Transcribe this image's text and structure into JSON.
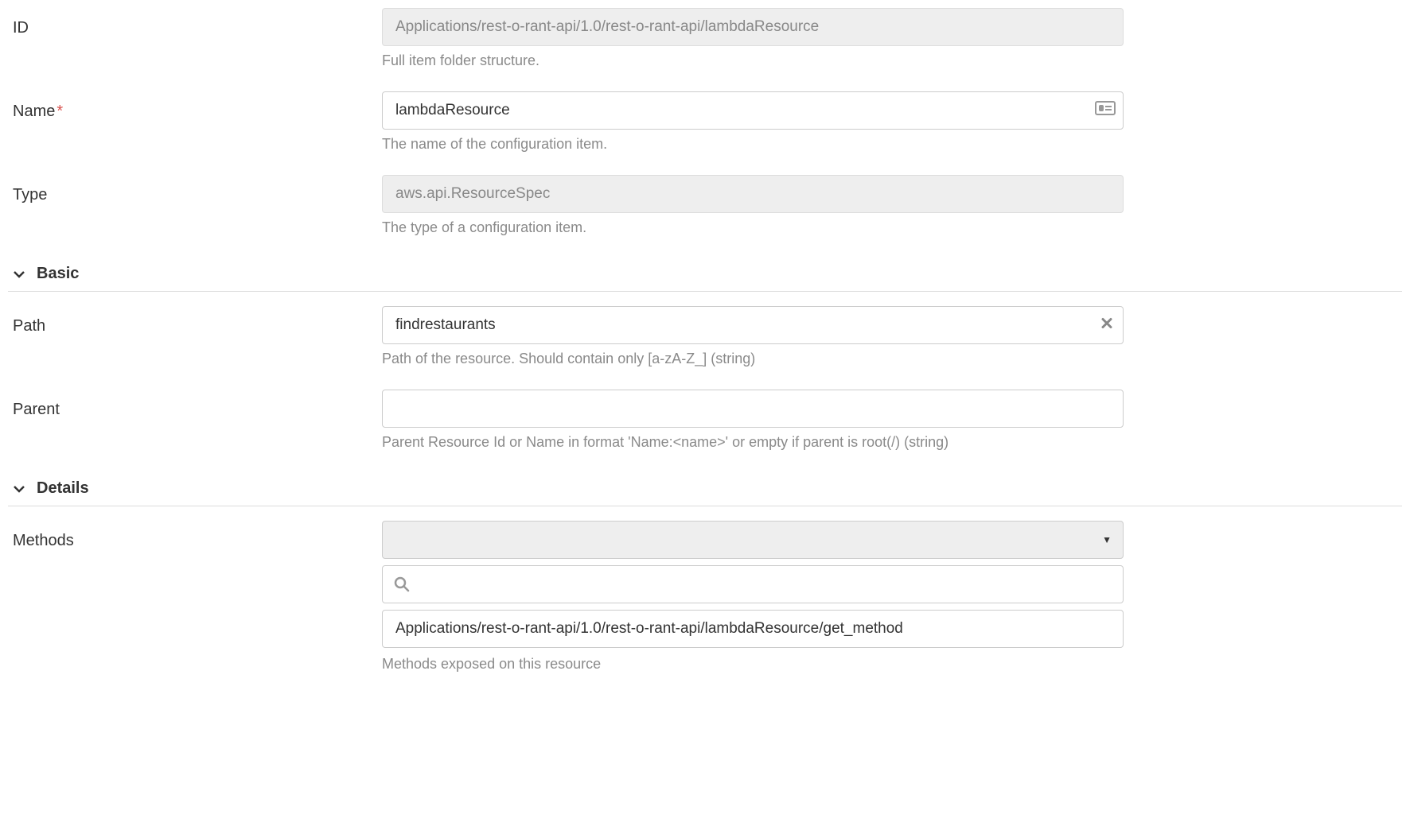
{
  "fields": {
    "id": {
      "label": "ID",
      "value": "Applications/rest-o-rant-api/1.0/rest-o-rant-api/lambdaResource",
      "help": "Full item folder structure."
    },
    "name": {
      "label": "Name",
      "required_marker": "*",
      "value": "lambdaResource",
      "help": "The name of the configuration item."
    },
    "type": {
      "label": "Type",
      "value": "aws.api.ResourceSpec",
      "help": "The type of a configuration item."
    },
    "path": {
      "label": "Path",
      "value": "findrestaurants",
      "help": "Path of the resource. Should contain only [a-zA-Z_] (string)"
    },
    "parent": {
      "label": "Parent",
      "value": "",
      "help": "Parent Resource Id or Name in format 'Name:<name>' or empty if parent is root(/) (string)"
    },
    "methods": {
      "label": "Methods",
      "selected": "",
      "search_value": "",
      "items": [
        "Applications/rest-o-rant-api/1.0/rest-o-rant-api/lambdaResource/get_method"
      ],
      "help": "Methods exposed on this resource"
    }
  },
  "sections": {
    "basic": "Basic",
    "details": "Details"
  }
}
